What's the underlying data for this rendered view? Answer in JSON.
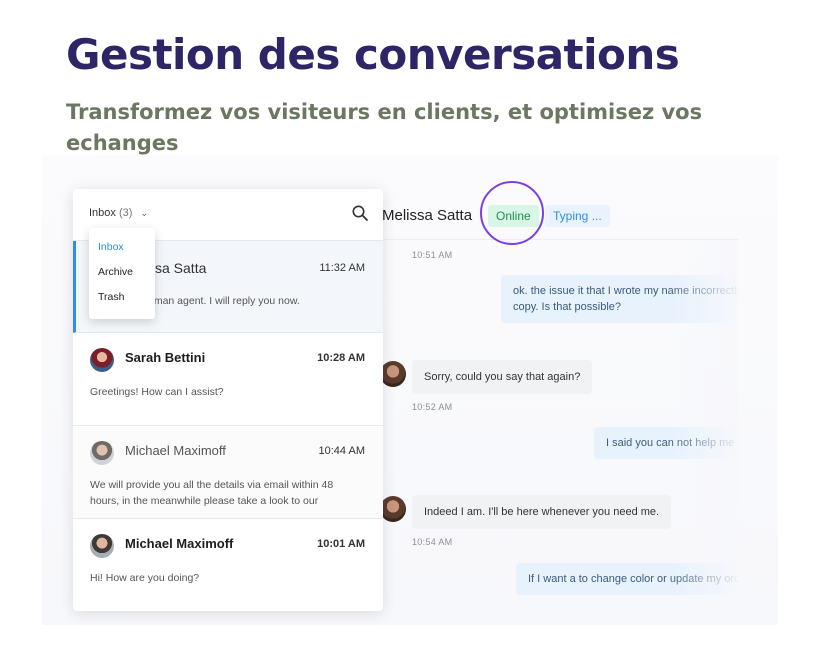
{
  "hero": {
    "title": "Gestion des conversations",
    "subtitle": "Transformez vos visiteurs en clients, et optimisez vos echanges"
  },
  "inbox": {
    "selector_label": "Inbox",
    "selector_count": "(3)",
    "dropdown_options": [
      "Inbox",
      "Archive",
      "Trash"
    ],
    "selected_option": "Inbox"
  },
  "conversations": [
    {
      "name": "Melissa Satta",
      "name_visible": "ssa Satta",
      "time": "11:32 AM",
      "preview": "uman agent. I will reply you now.",
      "active": true
    },
    {
      "name": "Sarah Bettini",
      "time": "10:28 AM",
      "preview": "Greetings! How can I assist?"
    },
    {
      "name": "Michael Maximoff",
      "time": "10:44 AM",
      "preview": "We will provide you all the details via email within 48 hours, in the meanwhile please take a look to our"
    },
    {
      "name": "Michael Maximoff",
      "time": "10:01 AM",
      "preview": "Hi! How are you doing?"
    }
  ],
  "chat": {
    "contact_name": "Melissa Satta",
    "contact_name_visible": "Melissa Satta",
    "status": "Online",
    "typing": "Typing ...",
    "messages": [
      {
        "dir": "out",
        "time": "10:51 AM",
        "text1": "ok. the issue it that I wrote my name incorrectly a",
        "text2": "copy. Is that possible?"
      },
      {
        "dir": "in",
        "time": "10:52 AM",
        "text1": "Sorry, could you say that again?"
      },
      {
        "dir": "out",
        "text1": "I said you can not help me du"
      },
      {
        "dir": "in",
        "time": "10:54 AM",
        "text1": "Indeed I am. I'll be here whenever you need me."
      },
      {
        "dir": "out",
        "text1": "If I want a to change color or update my order"
      }
    ]
  },
  "colors": {
    "title": "#2e2566",
    "subtitle": "#6b7760",
    "accent": "#2f8ee8",
    "online_bg": "#d9f5e6",
    "online_text": "#1f8f52",
    "highlight_ring": "#7b3fe4"
  }
}
